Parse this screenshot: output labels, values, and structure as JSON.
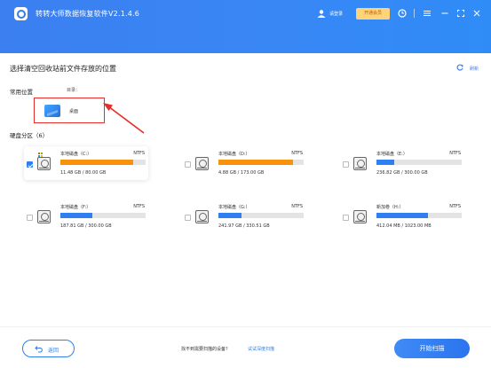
{
  "app": {
    "title": "转转大师数据恢复软件V2.1.4.6",
    "login": "请登录",
    "vip": "开通会员",
    "icons": [
      "user-icon",
      "headset-icon",
      "menu-icon",
      "minimize-icon",
      "maximize-icon",
      "close-icon"
    ]
  },
  "page": {
    "title": "选择清空回收站前文件存放的位置",
    "refresh": "刷新"
  },
  "common": {
    "title": "常用位置",
    "dir_label": "目录：",
    "folder": "桌面"
  },
  "disks": {
    "title": "硬盘分区（6）",
    "items": [
      {
        "name": "本地磁盘（C:）",
        "fs": "NTFS",
        "size": "11.48 GB / 80.00 GB",
        "used_fraction": 0.85,
        "color": "#f7920a",
        "checked": true,
        "system": true
      },
      {
        "name": "本地磁盘（D:）",
        "fs": "NTFS",
        "size": "4.88 GB / 173.00 GB",
        "used_fraction": 0.88,
        "color": "#f7920a",
        "checked": false,
        "system": false
      },
      {
        "name": "本地磁盘（E:）",
        "fs": "NTFS",
        "size": "236.82 GB / 300.00 GB",
        "used_fraction": 0.21,
        "color": "#2f7ff0",
        "checked": false,
        "system": false
      },
      {
        "name": "本地磁盘（F:）",
        "fs": "NTFS",
        "size": "187.81 GB / 300.00 GB",
        "used_fraction": 0.38,
        "color": "#2f7ff0",
        "checked": false,
        "system": false
      },
      {
        "name": "本地磁盘（G:）",
        "fs": "NTFS",
        "size": "241.97 GB / 330.51 GB",
        "used_fraction": 0.27,
        "color": "#2f7ff0",
        "checked": false,
        "system": false
      },
      {
        "name": "新加卷（H:）",
        "fs": "NTFS",
        "size": "412.04 MB / 1023.00 MB",
        "used_fraction": 0.6,
        "color": "#2f7ff0",
        "checked": false,
        "system": false
      }
    ]
  },
  "footer": {
    "back": "返回",
    "hint": "找不到需要扫描的设备？",
    "hint_link": "试试深度扫描",
    "start": "开始扫描"
  },
  "colors": {
    "accent": "#2f7ff0",
    "warning_bar": "#f7920a",
    "annotation": "#e82a2a"
  }
}
